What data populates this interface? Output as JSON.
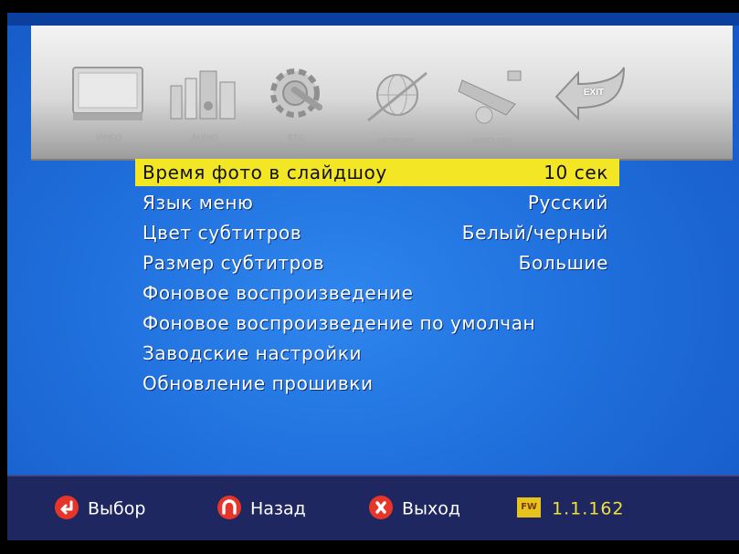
{
  "tabs": [
    {
      "label": "VIDEO",
      "icon": "monitor-icon"
    },
    {
      "label": "AUDIO",
      "icon": "speakers-icon"
    },
    {
      "label": "ETC",
      "icon": "gear-wrench-icon"
    },
    {
      "label": "NETWORK",
      "icon": "globe-network-icon"
    },
    {
      "label": "WIRELESS",
      "icon": "wireless-icon"
    },
    {
      "label": "EXIT",
      "icon": "exit-arrow-icon"
    }
  ],
  "menu": {
    "items": [
      {
        "label": "Время фото в слайдшоу",
        "value": "10 сек",
        "selected": true
      },
      {
        "label": "Язык меню",
        "value": "Русский"
      },
      {
        "label": "Цвет субтитров",
        "value": "Белый/черный"
      },
      {
        "label": "Размер субтитров",
        "value": "Большие"
      },
      {
        "label": "Фоновое воспроизведение",
        "value": ""
      },
      {
        "label": "Фоновое воспроизведение по умолчан",
        "value": ""
      },
      {
        "label": "Заводские настройки",
        "value": ""
      },
      {
        "label": "Обновление прошивки",
        "value": ""
      }
    ]
  },
  "footer": {
    "select_label": "Выбор",
    "back_label": "Назад",
    "exit_label": "Выход",
    "fw_badge": "FW",
    "fw_version": "1.1.162"
  },
  "colors": {
    "background": "#1f6fdc",
    "selection": "#f2e625",
    "footer": "#1f2760",
    "button_red": "#e8352a",
    "fw_text": "#f0e237"
  }
}
